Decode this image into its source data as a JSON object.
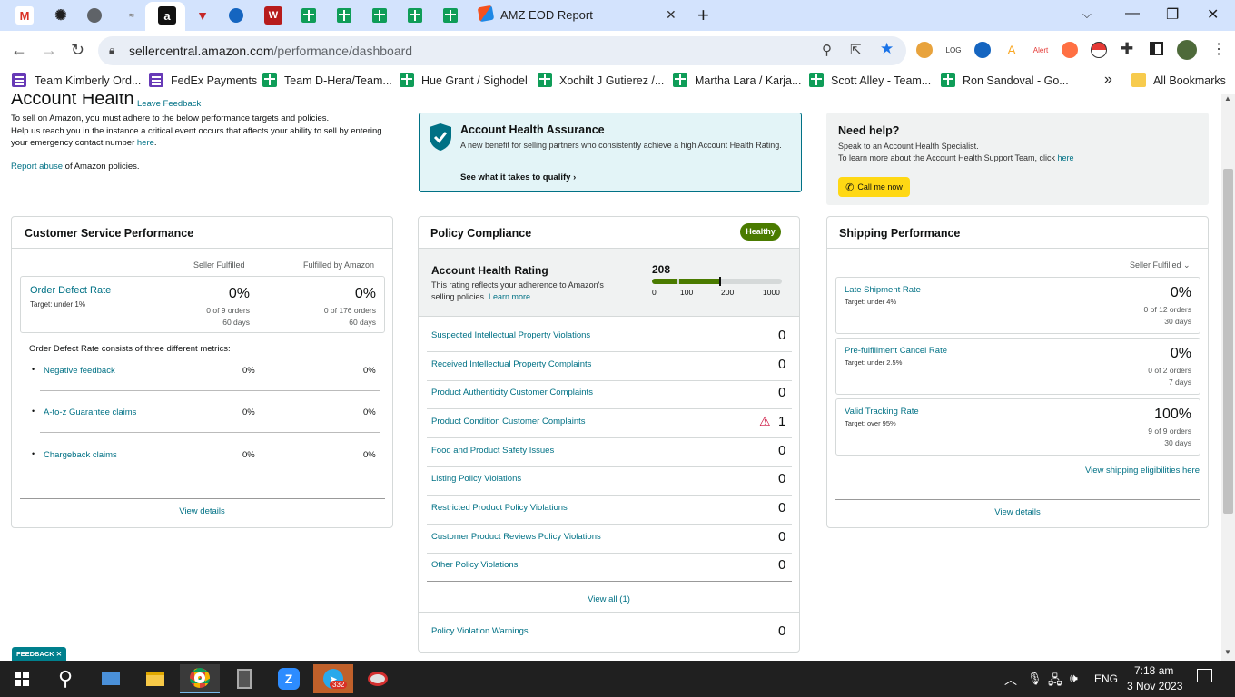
{
  "browser": {
    "tabs": [
      {
        "icon": "gmail-icon"
      },
      {
        "icon": "openai-icon"
      },
      {
        "icon": "globe-icon"
      },
      {
        "icon": "image-icon"
      },
      {
        "icon": "amazon-icon"
      },
      {
        "icon": "vector-icon"
      },
      {
        "icon": "dots-icon"
      },
      {
        "icon": "w-icon",
        "text": "W"
      },
      {
        "icon": "sheets-icon"
      },
      {
        "icon": "sheets-icon"
      },
      {
        "icon": "sheets-icon"
      },
      {
        "icon": "sheets-icon"
      },
      {
        "icon": "sheets-icon"
      }
    ],
    "active_tab_title": "AMZ EOD Report",
    "new_tab": "+",
    "close_tab": "✕",
    "url_host": "sellercentral.amazon.com",
    "url_path": "/performance/dashboard",
    "bookmarks": [
      {
        "label": "Team Kimberly Ord...",
        "icon": "form"
      },
      {
        "label": "FedEx Payments",
        "icon": "form"
      },
      {
        "label": "Team D-Hera/Team...",
        "icon": "sheet"
      },
      {
        "label": "Hue Grant / Sighodel",
        "icon": "sheet"
      },
      {
        "label": "Xochilt J Gutierez /...",
        "icon": "sheet"
      },
      {
        "label": "Martha Lara / Karja...",
        "icon": "sheet"
      },
      {
        "label": "Scott Alley - Team...",
        "icon": "sheet"
      },
      {
        "label": "Ron Sandoval - Go...",
        "icon": "sheet"
      }
    ],
    "bookmarks_overflow": "»",
    "all_bookmarks": "All Bookmarks"
  },
  "header": {
    "title": "Account Health",
    "leave_feedback": "Leave Feedback",
    "line1": "To sell on Amazon, you must adhere to the below performance targets and policies.",
    "line2": "Help us reach you in the instance a critical event occurs that affects your ability to sell by entering",
    "line3a": "your emergency contact number ",
    "line3_link": "here",
    "line3b": ".",
    "report_link": "Report abuse",
    "report_rest": " of Amazon policies."
  },
  "assurance": {
    "title": "Account Health Assurance",
    "desc": "A new benefit for selling partners who consistently achieve a high Account Health Rating.",
    "link": "See what it takes to qualify"
  },
  "help": {
    "title": "Need help?",
    "line1": "Speak to an Account Health Specialist.",
    "line2a": "To learn more about the Account Health Support Team, click ",
    "line2_link": "here",
    "button": "Call me now"
  },
  "customer_service": {
    "title": "Customer Service Performance",
    "col1": "Seller Fulfilled",
    "col2": "Fulfilled by Amazon",
    "odr_label": "Order Defect Rate",
    "odr_target": "Target: under 1%",
    "sf_value": "0%",
    "sf_orders": "0 of 9 orders",
    "sf_days": "60 days",
    "fba_value": "0%",
    "fba_orders": "0 of 176 orders",
    "fba_days": "60 days",
    "metrics_intro": "Order Defect Rate consists of three different metrics:",
    "metrics": [
      {
        "label": "Negative feedback",
        "sf": "0%",
        "fba": "0%"
      },
      {
        "label": "A-to-z Guarantee claims",
        "sf": "0%",
        "fba": "0%"
      },
      {
        "label": "Chargeback claims",
        "sf": "0%",
        "fba": "0%"
      }
    ],
    "view_details": "View details"
  },
  "policy": {
    "title": "Policy Compliance",
    "badge": "Healthy",
    "ahr_title": "Account Health Rating",
    "ahr_desc1": "This rating reflects your adherence to Amazon's",
    "ahr_desc2a": "selling policies. ",
    "ahr_desc2_link": "Learn more.",
    "rating": "208",
    "rating_value": 208,
    "scale": [
      "0",
      "100",
      "200",
      "1000"
    ],
    "rows": [
      {
        "label": "Suspected Intellectual Property Violations",
        "value": "0",
        "warn": false
      },
      {
        "label": "Received Intellectual Property Complaints",
        "value": "0",
        "warn": false
      },
      {
        "label": "Product Authenticity Customer Complaints",
        "value": "0",
        "warn": false
      },
      {
        "label": "Product Condition Customer Complaints",
        "value": "1",
        "warn": true
      },
      {
        "label": "Food and Product Safety Issues",
        "value": "0",
        "warn": false
      },
      {
        "label": "Listing Policy Violations",
        "value": "0",
        "warn": false
      },
      {
        "label": "Restricted Product Policy Violations",
        "value": "0",
        "warn": false
      },
      {
        "label": "Customer Product Reviews Policy Violations",
        "value": "0",
        "warn": false
      },
      {
        "label": "Other Policy Violations",
        "value": "0",
        "warn": false
      }
    ],
    "view_all": "View all (1)",
    "warnings_label": "Policy Violation Warnings",
    "warnings_value": "0"
  },
  "shipping": {
    "title": "Shipping Performance",
    "filter": "Seller Fulfilled",
    "metrics": [
      {
        "label": "Late Shipment Rate",
        "target": "Target: under 4%",
        "value": "0%",
        "orders": "0 of 12 orders",
        "days": "30 days"
      },
      {
        "label": "Pre-fulfillment Cancel Rate",
        "target": "Target: under 2.5%",
        "value": "0%",
        "orders": "0 of 2 orders",
        "days": "7 days"
      },
      {
        "label": "Valid Tracking Rate",
        "target": "Target: over 95%",
        "value": "100%",
        "orders": "9 of 9 orders",
        "days": "30 days"
      }
    ],
    "eligibility_link": "View shipping eligibilities here",
    "view_details": "View details"
  },
  "feedback_tab": "FEEDBACK ✕",
  "taskbar": {
    "telegram_badge": "332",
    "lang": "ENG",
    "time": "7:18 am",
    "date": "3 Nov 2023"
  },
  "colors": {
    "accent": "#007185",
    "healthy": "#4a7b00",
    "call_button": "#ffd814",
    "assurance_bg": "#e3f4f7"
  }
}
